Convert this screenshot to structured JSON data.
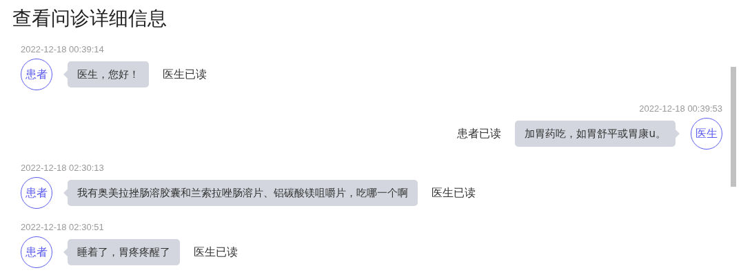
{
  "title": "查看问诊详细信息",
  "messages": [
    {
      "kind": "incoming",
      "time": "2022-12-18 00:39:14",
      "avatar": "患者",
      "text": "医生，您好！",
      "read_status": "医生已读"
    },
    {
      "kind": "outgoing",
      "time": "2022-12-18 00:39:53",
      "avatar": "医生",
      "text": "加胃药吃，如胃舒平或胃康u。",
      "read_status": "患者已读"
    },
    {
      "kind": "incoming",
      "time": "2022-12-18 02:30:13",
      "avatar": "患者",
      "text": "我有奥美拉挫肠溶胶囊和兰索拉唑肠溶片、铝碳酸镁咀嚼片，吃哪一个啊",
      "read_status": "医生已读"
    },
    {
      "kind": "incoming",
      "time": "2022-12-18 02:30:51",
      "avatar": "患者",
      "text": "睡着了，胃疼疼醒了",
      "read_status": "医生已读"
    }
  ]
}
